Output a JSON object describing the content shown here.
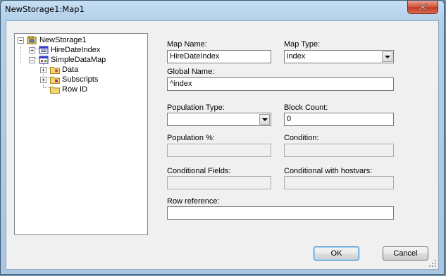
{
  "window": {
    "title": "NewStorage1:Map1",
    "close_label": "Close"
  },
  "tree": {
    "root": {
      "label": "NewStorage1",
      "icon": "storage-icon",
      "expanded": true
    },
    "nodes": [
      {
        "label": "HireDateIndex",
        "icon": "index-map-icon",
        "expanded": false
      },
      {
        "label": "SimpleDataMap",
        "icon": "data-map-icon",
        "expanded": true
      },
      {
        "label": "Data",
        "icon": "folder-icon",
        "expanded": false
      },
      {
        "label": "Subscripts",
        "icon": "folder-icon",
        "expanded": false
      },
      {
        "label": "Row ID",
        "icon": "folder-icon",
        "expanded": false
      }
    ]
  },
  "form": {
    "map_name": {
      "label": "Map Name:",
      "value": "HireDateIndex"
    },
    "map_type": {
      "label": "Map Type:",
      "value": "index"
    },
    "global_name": {
      "label": "Global Name:",
      "value": "^index"
    },
    "population_type": {
      "label": "Population Type:",
      "value": ""
    },
    "block_count": {
      "label": "Block Count:",
      "value": "0"
    },
    "population_pct": {
      "label": "Population %:",
      "value": ""
    },
    "condition": {
      "label": "Condition:",
      "value": ""
    },
    "conditional_fields": {
      "label": "Conditional Fields:",
      "value": ""
    },
    "conditional_hostvars": {
      "label": "Conditional with hostvars:",
      "value": ""
    },
    "row_reference": {
      "label": "Row reference:",
      "value": ""
    }
  },
  "buttons": {
    "ok": "OK",
    "cancel": "Cancel"
  }
}
